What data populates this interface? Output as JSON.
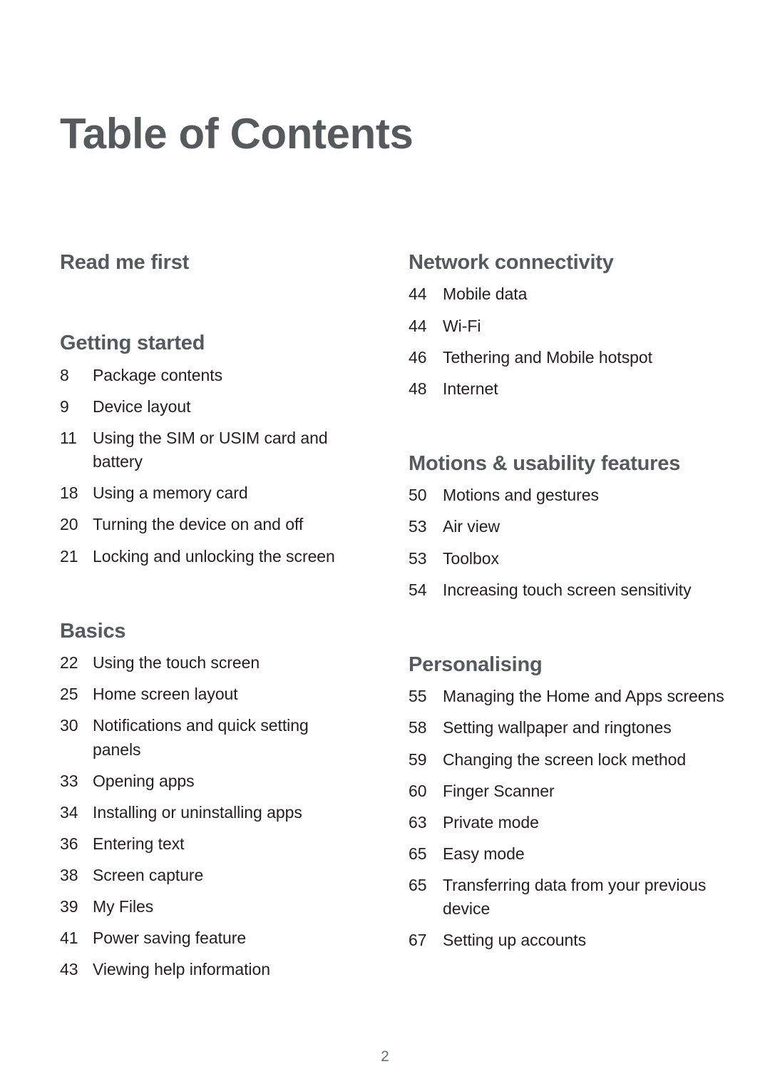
{
  "document": {
    "title": "Table of Contents",
    "footer_page_number": "2"
  },
  "colors": {
    "heading": "#58595B",
    "entry_text": "#231F20",
    "footer": "#6D6E71",
    "background": "#FFFFFF"
  },
  "columns": {
    "left": {
      "sections": [
        {
          "heading": "Read me first",
          "entries": []
        },
        {
          "heading": "Getting started",
          "entries": [
            {
              "page": "8",
              "label": "Package contents"
            },
            {
              "page": "9",
              "label": "Device layout"
            },
            {
              "page": "11",
              "label": "Using the SIM or USIM card and battery"
            },
            {
              "page": "18",
              "label": "Using a memory card"
            },
            {
              "page": "20",
              "label": "Turning the device on and off"
            },
            {
              "page": "21",
              "label": "Locking and unlocking the screen"
            }
          ]
        },
        {
          "heading": "Basics",
          "entries": [
            {
              "page": "22",
              "label": "Using the touch screen"
            },
            {
              "page": "25",
              "label": "Home screen layout"
            },
            {
              "page": "30",
              "label": "Notifications and quick setting panels"
            },
            {
              "page": "33",
              "label": "Opening apps"
            },
            {
              "page": "34",
              "label": "Installing or uninstalling apps"
            },
            {
              "page": "36",
              "label": "Entering text"
            },
            {
              "page": "38",
              "label": "Screen capture"
            },
            {
              "page": "39",
              "label": "My Files"
            },
            {
              "page": "41",
              "label": "Power saving feature"
            },
            {
              "page": "43",
              "label": "Viewing help information"
            }
          ]
        }
      ]
    },
    "right": {
      "sections": [
        {
          "heading": "Network connectivity",
          "entries": [
            {
              "page": "44",
              "label": "Mobile data"
            },
            {
              "page": "44",
              "label": "Wi-Fi"
            },
            {
              "page": "46",
              "label": "Tethering and Mobile hotspot"
            },
            {
              "page": "48",
              "label": "Internet"
            }
          ]
        },
        {
          "heading": "Motions & usability features",
          "entries": [
            {
              "page": "50",
              "label": "Motions and gestures"
            },
            {
              "page": "53",
              "label": "Air view"
            },
            {
              "page": "53",
              "label": "Toolbox"
            },
            {
              "page": "54",
              "label": "Increasing touch screen sensitivity"
            }
          ]
        },
        {
          "heading": "Personalising",
          "entries": [
            {
              "page": "55",
              "label": "Managing the Home and Apps screens"
            },
            {
              "page": "58",
              "label": "Setting wallpaper and ringtones"
            },
            {
              "page": "59",
              "label": "Changing the screen lock method"
            },
            {
              "page": "60",
              "label": "Finger Scanner"
            },
            {
              "page": "63",
              "label": "Private mode"
            },
            {
              "page": "65",
              "label": "Easy mode"
            },
            {
              "page": "65",
              "label": "Transferring data from your previous device"
            },
            {
              "page": "67",
              "label": "Setting up accounts"
            }
          ]
        }
      ]
    }
  }
}
